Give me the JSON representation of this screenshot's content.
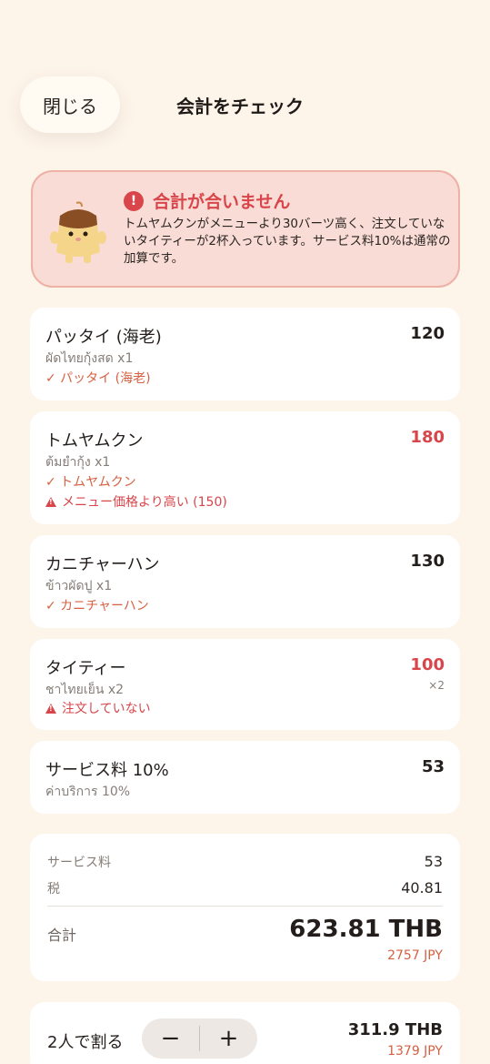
{
  "header": {
    "close_label": "閉じる",
    "title": "会計をチェック"
  },
  "alert": {
    "title": "合計が合いません",
    "body": "トムヤムクンがメニューより30バーツ高く、注文していないタイティーが2杯入っています。サービス料10%は通常の加算です。",
    "accent_color": "#D8454A"
  },
  "items": [
    {
      "name": "パッタイ (海老)",
      "price": "120",
      "thai": "ผัดไทยกุ้งสด x1",
      "match": "✓ パッタイ (海老)",
      "warning": "",
      "qty_tag": ""
    },
    {
      "name": "トムヤムクン",
      "price": "180",
      "thai": "ต้มยำกุ้ง x1",
      "match": "✓ トムヤムクン",
      "warning": "メニュー価格より高い (150)",
      "qty_tag": ""
    },
    {
      "name": "カニチャーハン",
      "price": "130",
      "thai": "ข้าวผัดปู x1",
      "match": "✓ カニチャーハン",
      "warning": "",
      "qty_tag": ""
    },
    {
      "name": "タイティー",
      "price": "100",
      "thai": "ชาไทยเย็น x2",
      "match": "",
      "warning": "注文していない",
      "qty_tag": "×2"
    },
    {
      "name": "サービス料 10%",
      "price": "53",
      "thai": "ค่าบริการ 10%",
      "match": "",
      "warning": "",
      "qty_tag": ""
    }
  ],
  "summary": {
    "service_label": "サービス料",
    "service_value": "53",
    "tax_label": "税",
    "tax_value": "40.81",
    "total_label": "合計",
    "total_value": "623.81 THB",
    "total_jpy": "2757 JPY"
  },
  "split": {
    "label": "2人で割る",
    "minus": "−",
    "plus": "+",
    "value": "311.9 THB",
    "jpy": "1379 JPY"
  }
}
